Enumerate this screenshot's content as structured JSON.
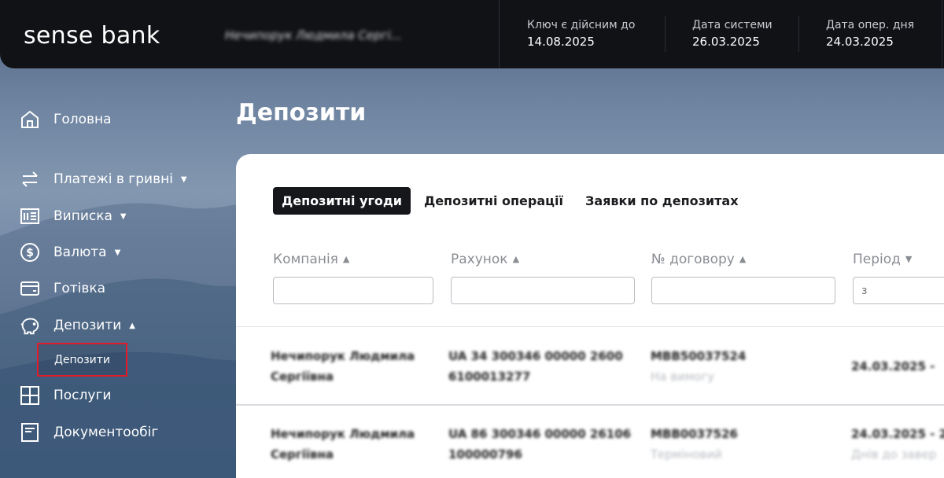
{
  "header": {
    "logo": "sense bank",
    "user_name": "Нечипорук Людмила Сергі...",
    "key_valid_label": "Ключ є дійсним до",
    "key_valid_value": "14.08.2025",
    "system_date_label": "Дата системи",
    "system_date_value": "26.03.2025",
    "oper_day_label": "Дата опер. дня",
    "oper_day_value": "24.03.2025"
  },
  "sidebar": {
    "items": [
      {
        "label": "Головна",
        "icon": "home-icon"
      },
      {
        "label": "Платежі в гривні",
        "icon": "transfer-arrows-icon"
      },
      {
        "label": "Виписка",
        "icon": "statement-icon"
      },
      {
        "label": "Валюта",
        "icon": "dollar-icon"
      },
      {
        "label": "Готівка",
        "icon": "wallet-icon"
      },
      {
        "label": "Депозити",
        "icon": "piggy-bank-icon"
      },
      {
        "label": "Послуги",
        "icon": "grid-icon"
      },
      {
        "label": "Документообіг",
        "icon": "document-icon"
      }
    ],
    "sub_item_label": "Депозити"
  },
  "main": {
    "title": "Депозити",
    "tabs": [
      {
        "label": "Депозитні угоди",
        "active": true
      },
      {
        "label": "Депозитні операції",
        "active": false
      },
      {
        "label": "Заявки по депозитах",
        "active": false
      }
    ],
    "filters": {
      "company_label": "Компанія",
      "account_label": "Рахунок",
      "contract_label": "№ договору",
      "period_label": "Період",
      "period_from_placeholder": "з"
    },
    "rows": [
      {
        "company_line1": "Нечипорук Людмила",
        "company_line2": "Сергіївна",
        "account_line1": "UA 34 300346 00000 2600",
        "account_line2": "6100013277",
        "contract_line1": "MBB50037524",
        "contract_line2": "На вимогу",
        "period_line1": "24.03.2025 -",
        "period_line2": ""
      },
      {
        "company_line1": "Нечипорук Людмила",
        "company_line2": "Сергіївна",
        "account_line1": "UA 86 300346 00000 26106",
        "account_line2": "100000796",
        "contract_line1": "MBB0037526",
        "contract_line2": "Терміновий",
        "period_line1": "24.03.2025 - 2",
        "period_line2": "Днів до завер"
      }
    ]
  },
  "colors": {
    "header_bg": "#111216",
    "active_tab_bg": "#16171b",
    "highlight_border": "#e01c2a"
  }
}
